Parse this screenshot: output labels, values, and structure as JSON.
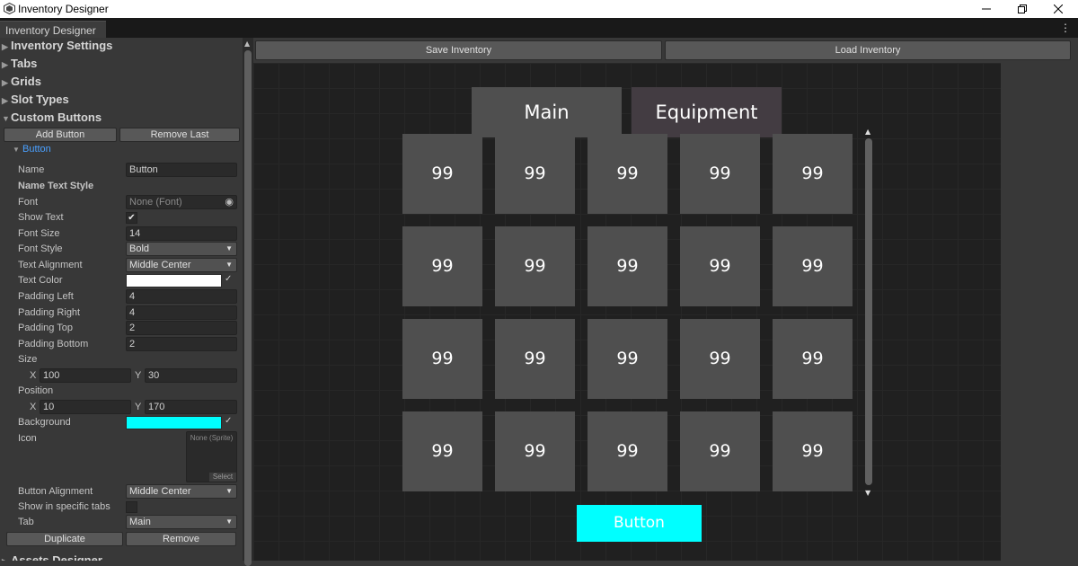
{
  "window": {
    "title": "Inventory Designer",
    "controls": [
      "minimize",
      "restore",
      "close"
    ]
  },
  "tabs": {
    "active": "Inventory Designer",
    "menu_icon": "kebab-menu-icon"
  },
  "inspector": {
    "sections": [
      {
        "label": "Inventory Settings",
        "expanded": false
      },
      {
        "label": "Tabs",
        "expanded": false
      },
      {
        "label": "Grids",
        "expanded": false
      },
      {
        "label": "Slot Types",
        "expanded": false
      },
      {
        "label": "Custom Buttons",
        "expanded": true
      }
    ],
    "add_button": "Add Button",
    "remove_last": "Remove Last",
    "item_foldout": "Button",
    "props": {
      "name_label": "Name",
      "name_value": "Button",
      "name_text_style": "Name Text Style",
      "font_label": "Font",
      "font_value": "None (Font)",
      "show_text_label": "Show Text",
      "show_text_value": "✔",
      "font_size_label": "Font Size",
      "font_size_value": "14",
      "font_style_label": "Font Style",
      "font_style_value": "Bold",
      "text_alignment_label": "Text Alignment",
      "text_alignment_value": "Middle Center",
      "text_color_label": "Text Color",
      "text_color": "#ffffff",
      "padding_left_label": "Padding Left",
      "padding_left_value": "4",
      "padding_right_label": "Padding Right",
      "padding_right_value": "4",
      "padding_top_label": "Padding Top",
      "padding_top_value": "2",
      "padding_bottom_label": "Padding Bottom",
      "padding_bottom_value": "2",
      "size_label": "Size",
      "size_x_label": "X",
      "size_x": "100",
      "size_y_label": "Y",
      "size_y": "30",
      "position_label": "Position",
      "pos_x_label": "X",
      "pos_x": "10",
      "pos_y_label": "Y",
      "pos_y": "170",
      "background_label": "Background",
      "background_color": "#00ffff",
      "icon_label": "Icon",
      "icon_value": "None (Sprite)",
      "icon_select": "Select",
      "button_alignment_label": "Button Alignment",
      "button_alignment_value": "Middle Center",
      "show_specific_tabs_label": "Show in specific tabs",
      "tab_label": "Tab",
      "tab_value": "Main"
    },
    "duplicate": "Duplicate",
    "remove": "Remove",
    "next_section_partial": "Assets Designer"
  },
  "toolbar": {
    "save": "Save Inventory",
    "load": "Load Inventory"
  },
  "preview": {
    "tabs": [
      {
        "label": "Main",
        "active": true,
        "color": "#4f4f4f"
      },
      {
        "label": "Equipment",
        "active": false,
        "color": "#433c42"
      }
    ],
    "slot_rows": [
      [
        "99",
        "99",
        "99",
        "99",
        "99"
      ],
      [
        "99",
        "99",
        "99",
        "99",
        "99"
      ],
      [
        "99",
        "99",
        "99",
        "99",
        "99"
      ],
      [
        "99",
        "99",
        "99",
        "99",
        "99"
      ]
    ],
    "custom_button": "Button",
    "custom_button_color": "#00ffff"
  }
}
